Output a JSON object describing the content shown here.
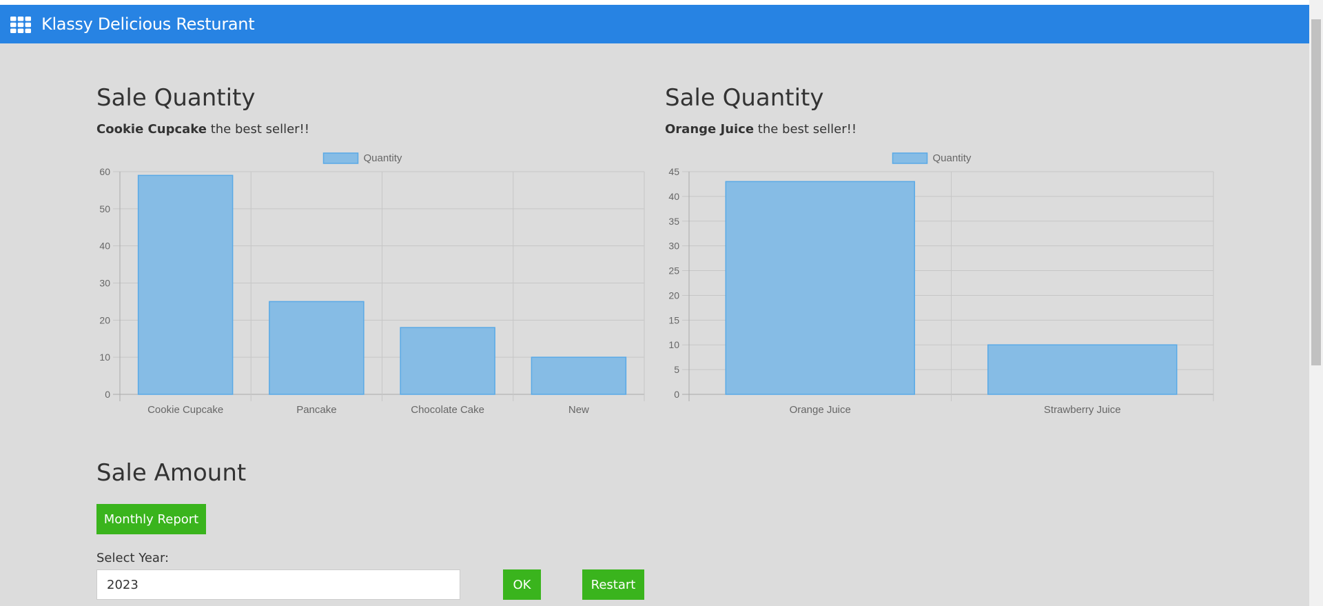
{
  "navbar": {
    "brand": "Klassy Delicious Resturant",
    "icon": "grid-icon",
    "color": "#2783e3"
  },
  "sales_food": {
    "title": "Sale Quantity",
    "best_name": "Cookie Cupcake",
    "best_suffix": " the best seller!!"
  },
  "sales_drink": {
    "title": "Sale Quantity",
    "best_name": "Orange Juice",
    "best_suffix": " the best seller!!"
  },
  "amount": {
    "title": "Sale Amount",
    "monthly_report_label": "Monthly Report",
    "select_year_label": "Select Year:",
    "year_value": "2023",
    "ok_label": "OK",
    "restart_label": "Restart",
    "button_color": "#3ab41d"
  },
  "chart_data": [
    {
      "type": "bar",
      "legend": "Quantity",
      "legend_position": "top",
      "categories": [
        "Cookie Cupcake",
        "Pancake",
        "Chocolate Cake",
        "New"
      ],
      "values": [
        59,
        25,
        18,
        10
      ],
      "ylim": [
        0,
        60
      ],
      "yticks": [
        0,
        10,
        20,
        30,
        40,
        50,
        60
      ],
      "grid": true,
      "bar_color": "#86bce5",
      "bar_border": "#59a9e6"
    },
    {
      "type": "bar",
      "legend": "Quantity",
      "legend_position": "top",
      "categories": [
        "Orange Juice",
        "Strawberry Juice"
      ],
      "values": [
        43,
        10
      ],
      "ylim": [
        0,
        45
      ],
      "yticks": [
        0,
        5,
        10,
        15,
        20,
        25,
        30,
        35,
        40,
        45
      ],
      "grid": true,
      "bar_color": "#86bce5",
      "bar_border": "#59a9e6"
    }
  ]
}
